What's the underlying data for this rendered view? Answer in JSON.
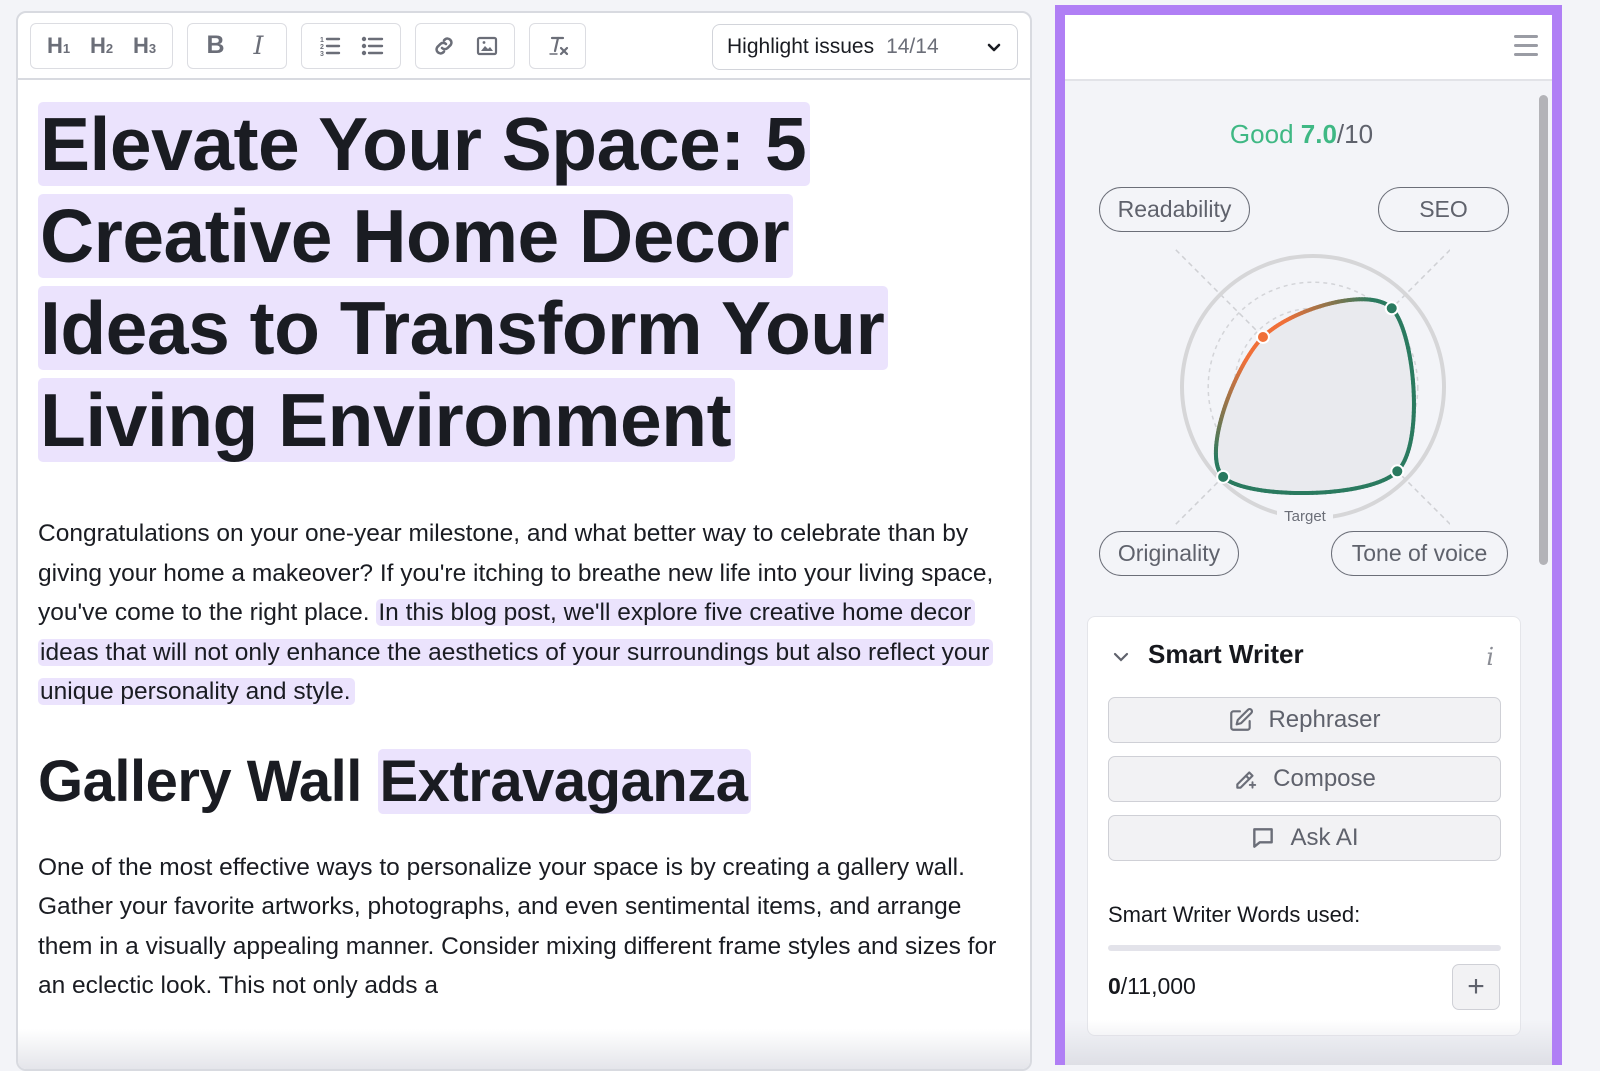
{
  "toolbar": {
    "h1": "H",
    "h1_sub": "1",
    "h2": "H",
    "h2_sub": "2",
    "h3": "H",
    "h3_sub": "3",
    "bold": "B",
    "italic": "I",
    "highlight_label": "Highlight issues",
    "highlight_count": "14/14"
  },
  "document": {
    "title_lines": [
      "Elevate Your Space: 5",
      "Creative Home Decor",
      "Ideas to Transform Your",
      "Living Environment"
    ],
    "intro_plain": "Congratulations on your one-year milestone, and what better way to celebrate than by giving your home a makeover? If you're itching to breathe new life into your living space, you've come to the right place. ",
    "intro_highlight": "In this blog post, we'll explore five creative home decor ideas that will not only enhance the aesthetics of your surroundings but also reflect your unique personality and style.",
    "section_heading_plain": "Gallery Wall ",
    "section_heading_highlight": "Extravaganza",
    "section_para": "One of the most effective ways to personalize your space is by creating a gallery wall. Gather your favorite artworks, photographs, and even sentimental items, and arrange them in a visually appealing manner. Consider mixing different frame styles and sizes for an eclectic look. This not only adds a"
  },
  "panel": {
    "score_label": "Good",
    "score_value": "7.0",
    "score_max": "/10",
    "colors": {
      "good": "#3fb884",
      "warning": "#f07039",
      "ok_line": "#2a7a5f",
      "accent": "#b07ff5",
      "highlight": "#ebe3fd"
    }
  },
  "chart_data": {
    "type": "radar",
    "title": "Good 7.0/10",
    "axes": [
      "Readability",
      "SEO",
      "Tone of voice",
      "Originality"
    ],
    "values": [
      0.54,
      0.85,
      0.91,
      0.97
    ],
    "status": [
      "warning",
      "good",
      "good",
      "good"
    ],
    "target_label": "Target",
    "target_value": 1.0,
    "range": [
      0,
      1
    ]
  },
  "smart_writer": {
    "title": "Smart Writer",
    "info": "i",
    "buttons": [
      "Rephraser",
      "Compose",
      "Ask AI"
    ],
    "words_used_label": "Smart Writer Words used:",
    "words_used": "0",
    "words_limit": "/11,000",
    "usage_fraction": 0,
    "add_label": "+"
  }
}
